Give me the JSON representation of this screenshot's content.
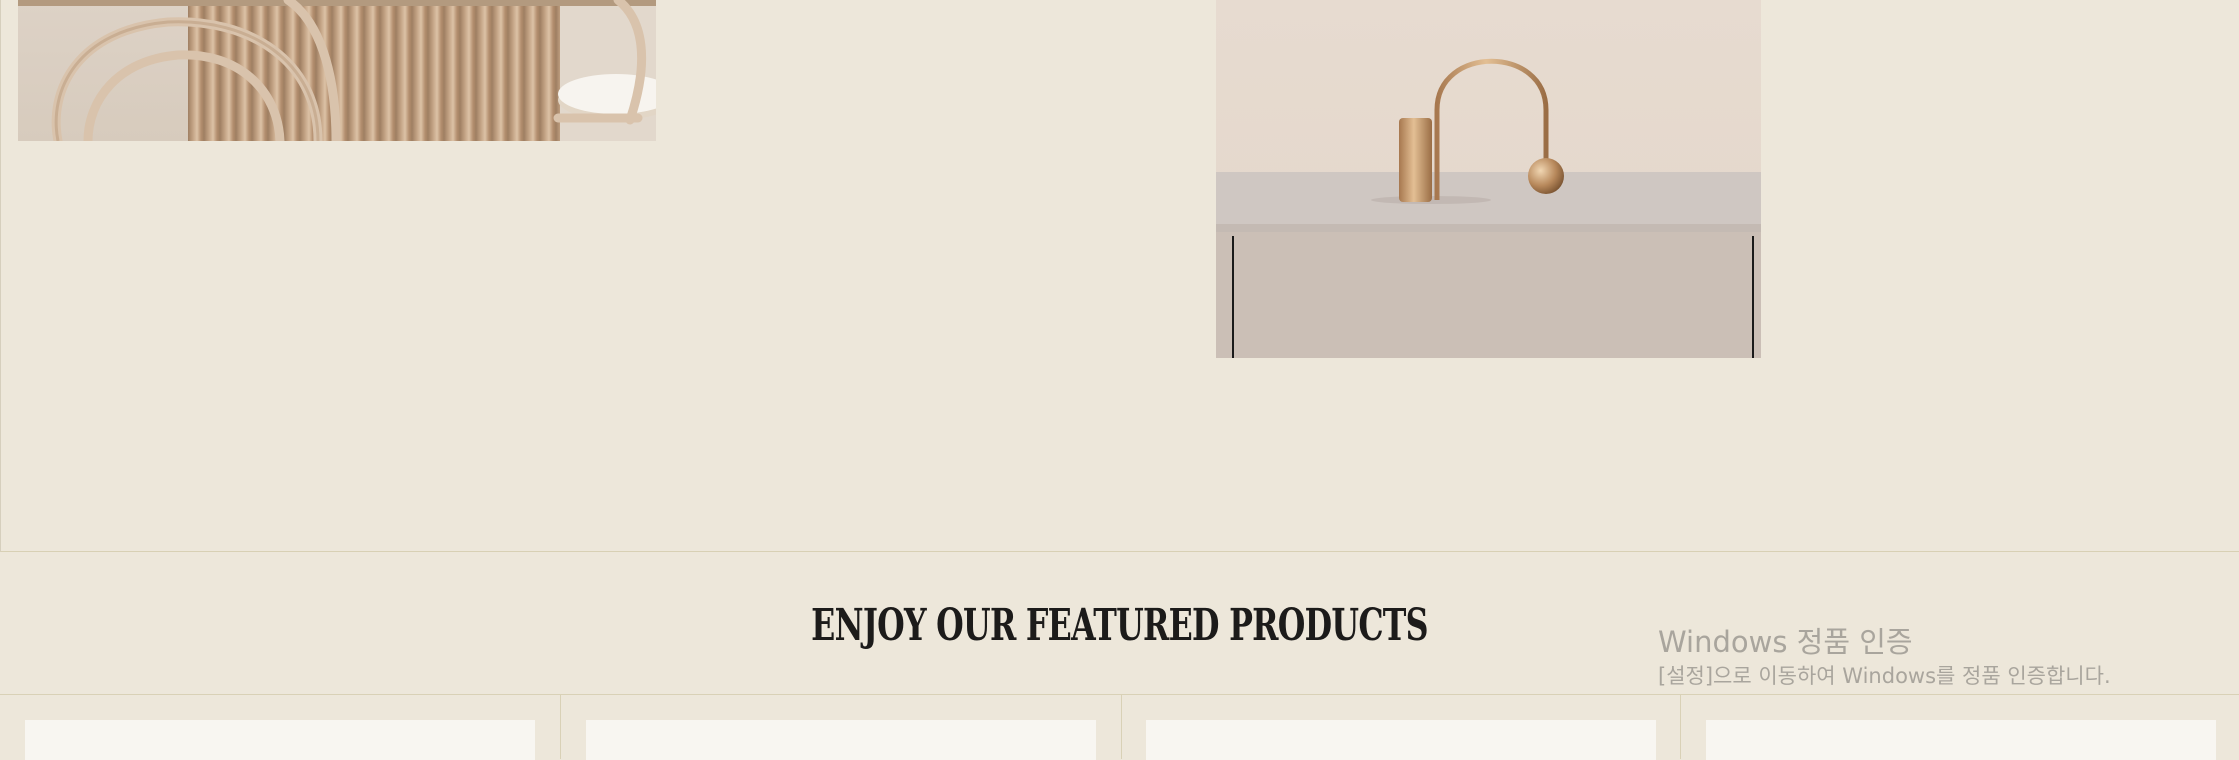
{
  "featured": {
    "heading": "ENJOY OUR FEATURED PRODUCTS"
  },
  "product_cards_count": 4,
  "images": {
    "left": "dining-chair-fluted-table-image",
    "right": "sideboard-brass-sculpture-image"
  },
  "watermark": {
    "title": "Windows 정품 인증",
    "subtitle": "[설정]으로 이동하여 Windows를 정품 인증합니다."
  },
  "colors": {
    "background": "#ede7da",
    "heading": "#1c1b1a",
    "card": "#f8f6f1",
    "divider": "#d9d1b6"
  }
}
